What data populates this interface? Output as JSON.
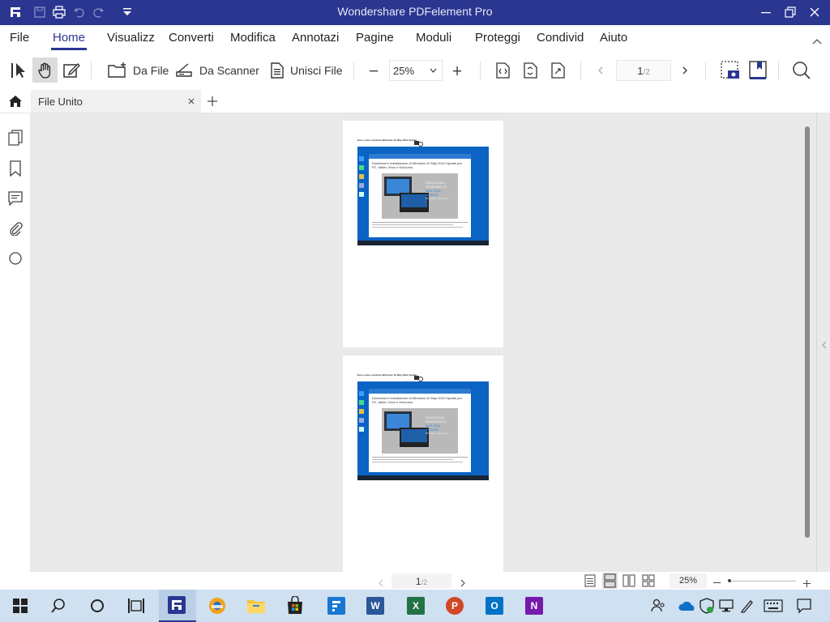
{
  "window": {
    "title": "Wondershare PDFelement Pro"
  },
  "menu": {
    "items": [
      {
        "label": "File"
      },
      {
        "label": "Home"
      },
      {
        "label": "Visualizz"
      },
      {
        "label": "Converti"
      },
      {
        "label": "Modifica"
      },
      {
        "label": "Annotazi"
      },
      {
        "label": "Pagine"
      },
      {
        "label": "Moduli"
      },
      {
        "label": "Proteggi"
      },
      {
        "label": "Condivid"
      },
      {
        "label": "Aiuto"
      }
    ]
  },
  "toolbar": {
    "from_file": "Da File",
    "from_scanner": "Da Scanner",
    "merge_files": "Unisci File",
    "zoom": "25%",
    "page_current": "1",
    "page_total": "/2"
  },
  "tabs": {
    "document": "File Unito"
  },
  "document": {
    "page_heading": "Ecco come scaricare Windows 10 May 2019 Update",
    "shot_heading": "Download e installazione di Windows 10 May 2019 Update per PC, tablet, Xbox e HoloLens",
    "banner": {
      "line1": "DOWNLOAD",
      "line2": "WINDOWS 10",
      "line3": "MAY 2019",
      "line4": "UPDATE",
      "line5": "PC | Xbox | HoloLens"
    }
  },
  "status": {
    "page_current": "1",
    "page_total": "/2",
    "zoom": "25%"
  },
  "colors": {
    "brand": "#2a3690",
    "taskbar": "#cfe0f0",
    "workspace": "#e9e9e9"
  }
}
